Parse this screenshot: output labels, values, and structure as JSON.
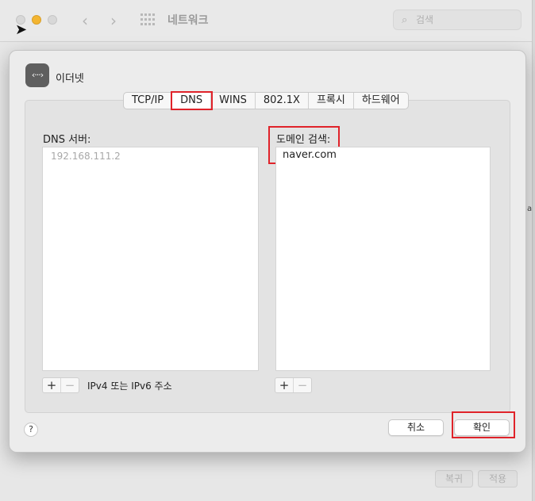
{
  "background_window": {
    "title": "네트워크",
    "search_placeholder": "검색",
    "revert_label": "복귀",
    "apply_label": "적용",
    "edge_text": "a"
  },
  "sheet": {
    "service_title": "이더넷",
    "service_icon_glyph": "‹···›",
    "tabs": [
      {
        "label": "TCP/IP",
        "active": false
      },
      {
        "label": "DNS",
        "active": true
      },
      {
        "label": "WINS",
        "active": false
      },
      {
        "label": "802.1X",
        "active": false
      },
      {
        "label": "프록시",
        "active": false
      },
      {
        "label": "하드웨어",
        "active": false
      }
    ],
    "dns_servers": {
      "label": "DNS 서버:",
      "items": [
        "192.168.111.2"
      ],
      "hint": "IPv4 또는 IPv6 주소"
    },
    "search_domains": {
      "label": "도메인 검색:",
      "items": [
        "naver.com"
      ]
    },
    "add_label": "+",
    "remove_label": "−",
    "help_label": "?",
    "cancel_label": "취소",
    "ok_label": "확인"
  },
  "colors": {
    "highlight": "#e0232a",
    "minimize": "#f3b531"
  }
}
